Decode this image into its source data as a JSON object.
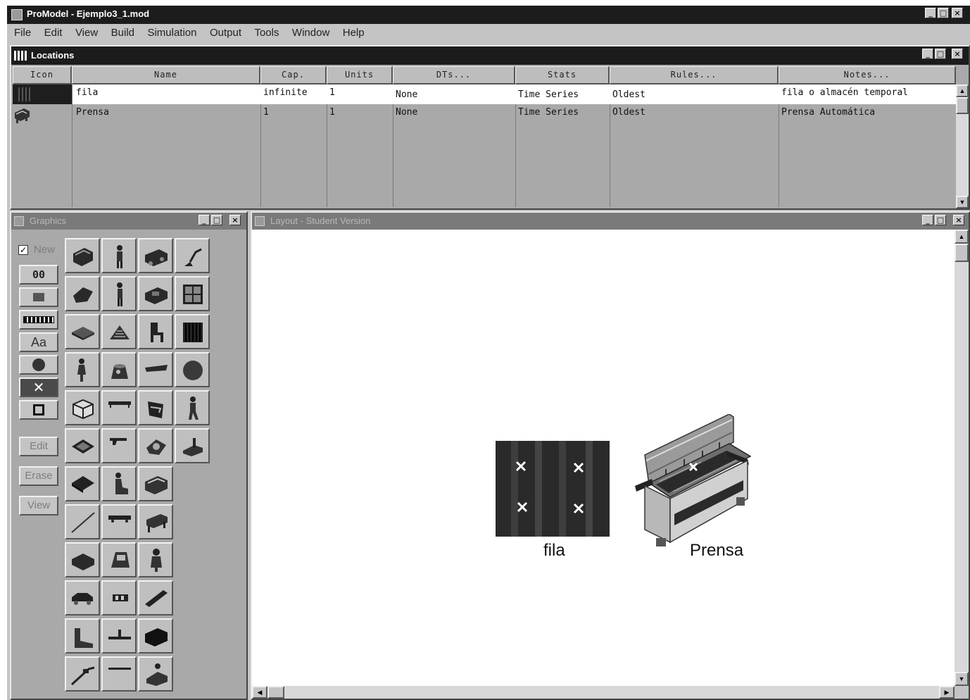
{
  "app": {
    "title": "ProModel - Ejemplo3_1.mod",
    "menu": [
      "File",
      "Edit",
      "View",
      "Build",
      "Simulation",
      "Output",
      "Tools",
      "Window",
      "Help"
    ]
  },
  "locations": {
    "title": "Locations",
    "columns": [
      "Icon",
      "Name",
      "Cap.",
      "Units",
      "DTs...",
      "Stats",
      "Rules...",
      "Notes..."
    ],
    "rows": [
      {
        "name": "fila",
        "cap": "infinite",
        "units": "1",
        "dts": "None",
        "stats": "Time Series",
        "rules": "Oldest",
        "notes": "fila o almacén temporal"
      },
      {
        "name": "Prensa",
        "cap": "1",
        "units": "1",
        "dts": "None",
        "stats": "Time Series",
        "rules": "Oldest",
        "notes": "Prensa Automática"
      }
    ]
  },
  "graphics": {
    "title": "Graphics",
    "new_label": "New",
    "new_checked": true,
    "left_tools": [
      "00",
      "Aa"
    ],
    "buttons": {
      "edit": "Edit",
      "erase": "Erase",
      "view": "View"
    }
  },
  "layout": {
    "title": "Layout - Student Version",
    "labels": {
      "fila": "fila",
      "prensa": "Prensa"
    }
  },
  "icons": [
    "app-icon",
    "minimize-icon",
    "maximize-icon",
    "close-icon",
    "scroll-up-icon",
    "scroll-down-icon",
    "scroll-left-icon",
    "scroll-right-icon",
    "machine-icon"
  ]
}
